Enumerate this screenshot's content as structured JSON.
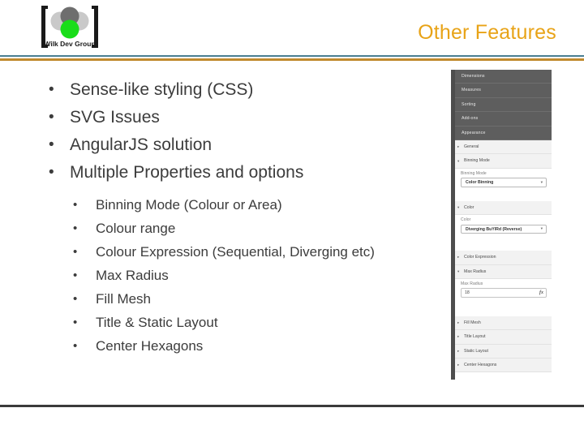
{
  "header": {
    "title": "Other Features",
    "title_color": "#e8a317",
    "logo": {
      "name": "wilk-dev-group-logo",
      "wordmark": "Wilk Dev Group",
      "colors": {
        "top_circle": "#6e6e6e",
        "left_circle": "#c9c9c9",
        "right_circle": "#c9c9c9",
        "bottom_circle": "#19dd19",
        "bracket": "#1a1a1a"
      }
    },
    "rule_teal_color": "#4a7f92",
    "rule_gold_color": "#c08a2e"
  },
  "content": {
    "bullet_glyph": "•",
    "level1": [
      {
        "text": "Sense-like styling (CSS)"
      },
      {
        "text": "SVG Issues"
      },
      {
        "text": "AngularJS solution"
      },
      {
        "text": "Multiple Properties and options"
      }
    ],
    "level2": [
      {
        "text": "Binning Mode (Colour or Area)"
      },
      {
        "text": "Colour range"
      },
      {
        "text": "Colour Expression (Sequential, Diverging etc)"
      },
      {
        "text": "Max Radius"
      },
      {
        "text": "Fill Mesh"
      },
      {
        "text": "Title & Static Layout"
      },
      {
        "text": "Center Hexagons"
      }
    ]
  },
  "app_panel": {
    "name": "qlik-properties-panel",
    "dark_sections": [
      {
        "label": "Dimensions"
      },
      {
        "label": "Measures"
      },
      {
        "label": "Sorting"
      },
      {
        "label": "Add-ons"
      },
      {
        "label": "Appearance"
      }
    ],
    "accordion": {
      "general": {
        "label": "General",
        "caret": "▸",
        "expanded": false
      },
      "binning_mode": {
        "label": "Binning Mode",
        "caret": "▾",
        "expanded": true
      },
      "color": {
        "label": "Color",
        "caret": "▾",
        "expanded": true
      },
      "color_expression": {
        "label": "Color Expression",
        "caret": "▸",
        "expanded": false
      },
      "max_radius": {
        "label": "Max Radius",
        "caret": "▾",
        "expanded": true
      },
      "fill_mesh": {
        "label": "Fill Mesh",
        "caret": "▸",
        "expanded": false
      },
      "title_layout": {
        "label": "Title Layout",
        "caret": "▸",
        "expanded": false
      },
      "static_layout": {
        "label": "Static Layout",
        "caret": "▸",
        "expanded": false
      },
      "center_hexagons": {
        "label": "Center Hexagons",
        "caret": "▸",
        "expanded": false
      }
    },
    "fields": {
      "binning_mode": {
        "label": "Binning Mode",
        "value": "Color Binning",
        "arrow": "▾"
      },
      "color": {
        "label": "Color",
        "value": "Diverging BuYlRd (Reverse)",
        "arrow": "▾"
      },
      "max_radius": {
        "label": "Max Radius",
        "value": "18",
        "fx_glyph": "fx"
      }
    }
  },
  "footer": {
    "rule_color": "#3a3a3a"
  }
}
